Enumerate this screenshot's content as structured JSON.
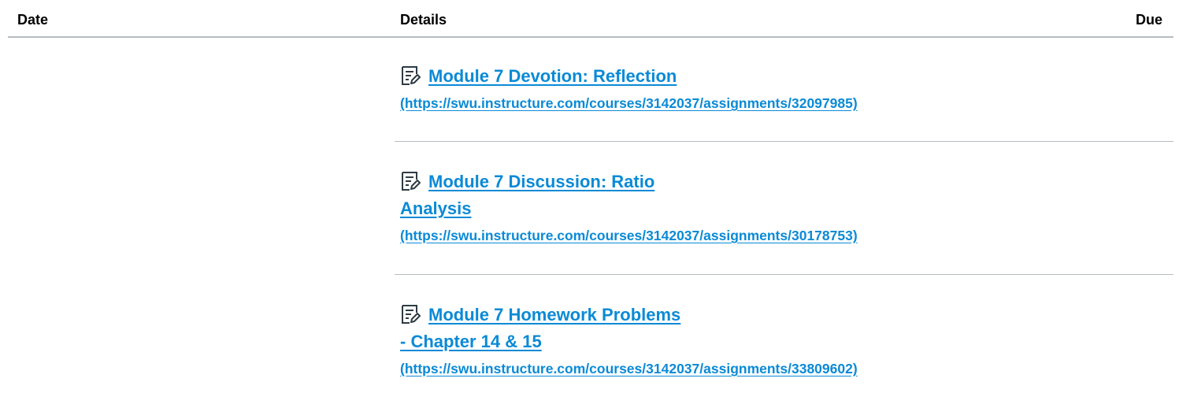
{
  "table": {
    "headers": {
      "date": "Date",
      "details": "Details",
      "due": "Due"
    },
    "rows": [
      {
        "icon": "assignment-icon",
        "title_line1": "Module 7 Devotion: Reflection",
        "title_line2": "",
        "url": "(https://swu.instructure.com/courses/3142037/assignments/32097985)"
      },
      {
        "icon": "assignment-icon",
        "title_line1": "Module 7 Discussion: Ratio",
        "title_line2": "Analysis",
        "url": "(https://swu.instructure.com/courses/3142037/assignments/30178753)"
      },
      {
        "icon": "assignment-icon",
        "title_line1": "Module 7 Homework Problems",
        "title_line2": "- Chapter 14 & 15",
        "url": "(https://swu.instructure.com/courses/3142037/assignments/33809602)"
      }
    ]
  },
  "colors": {
    "link": "#0a8ad6",
    "divider": "#b6bcc2"
  }
}
